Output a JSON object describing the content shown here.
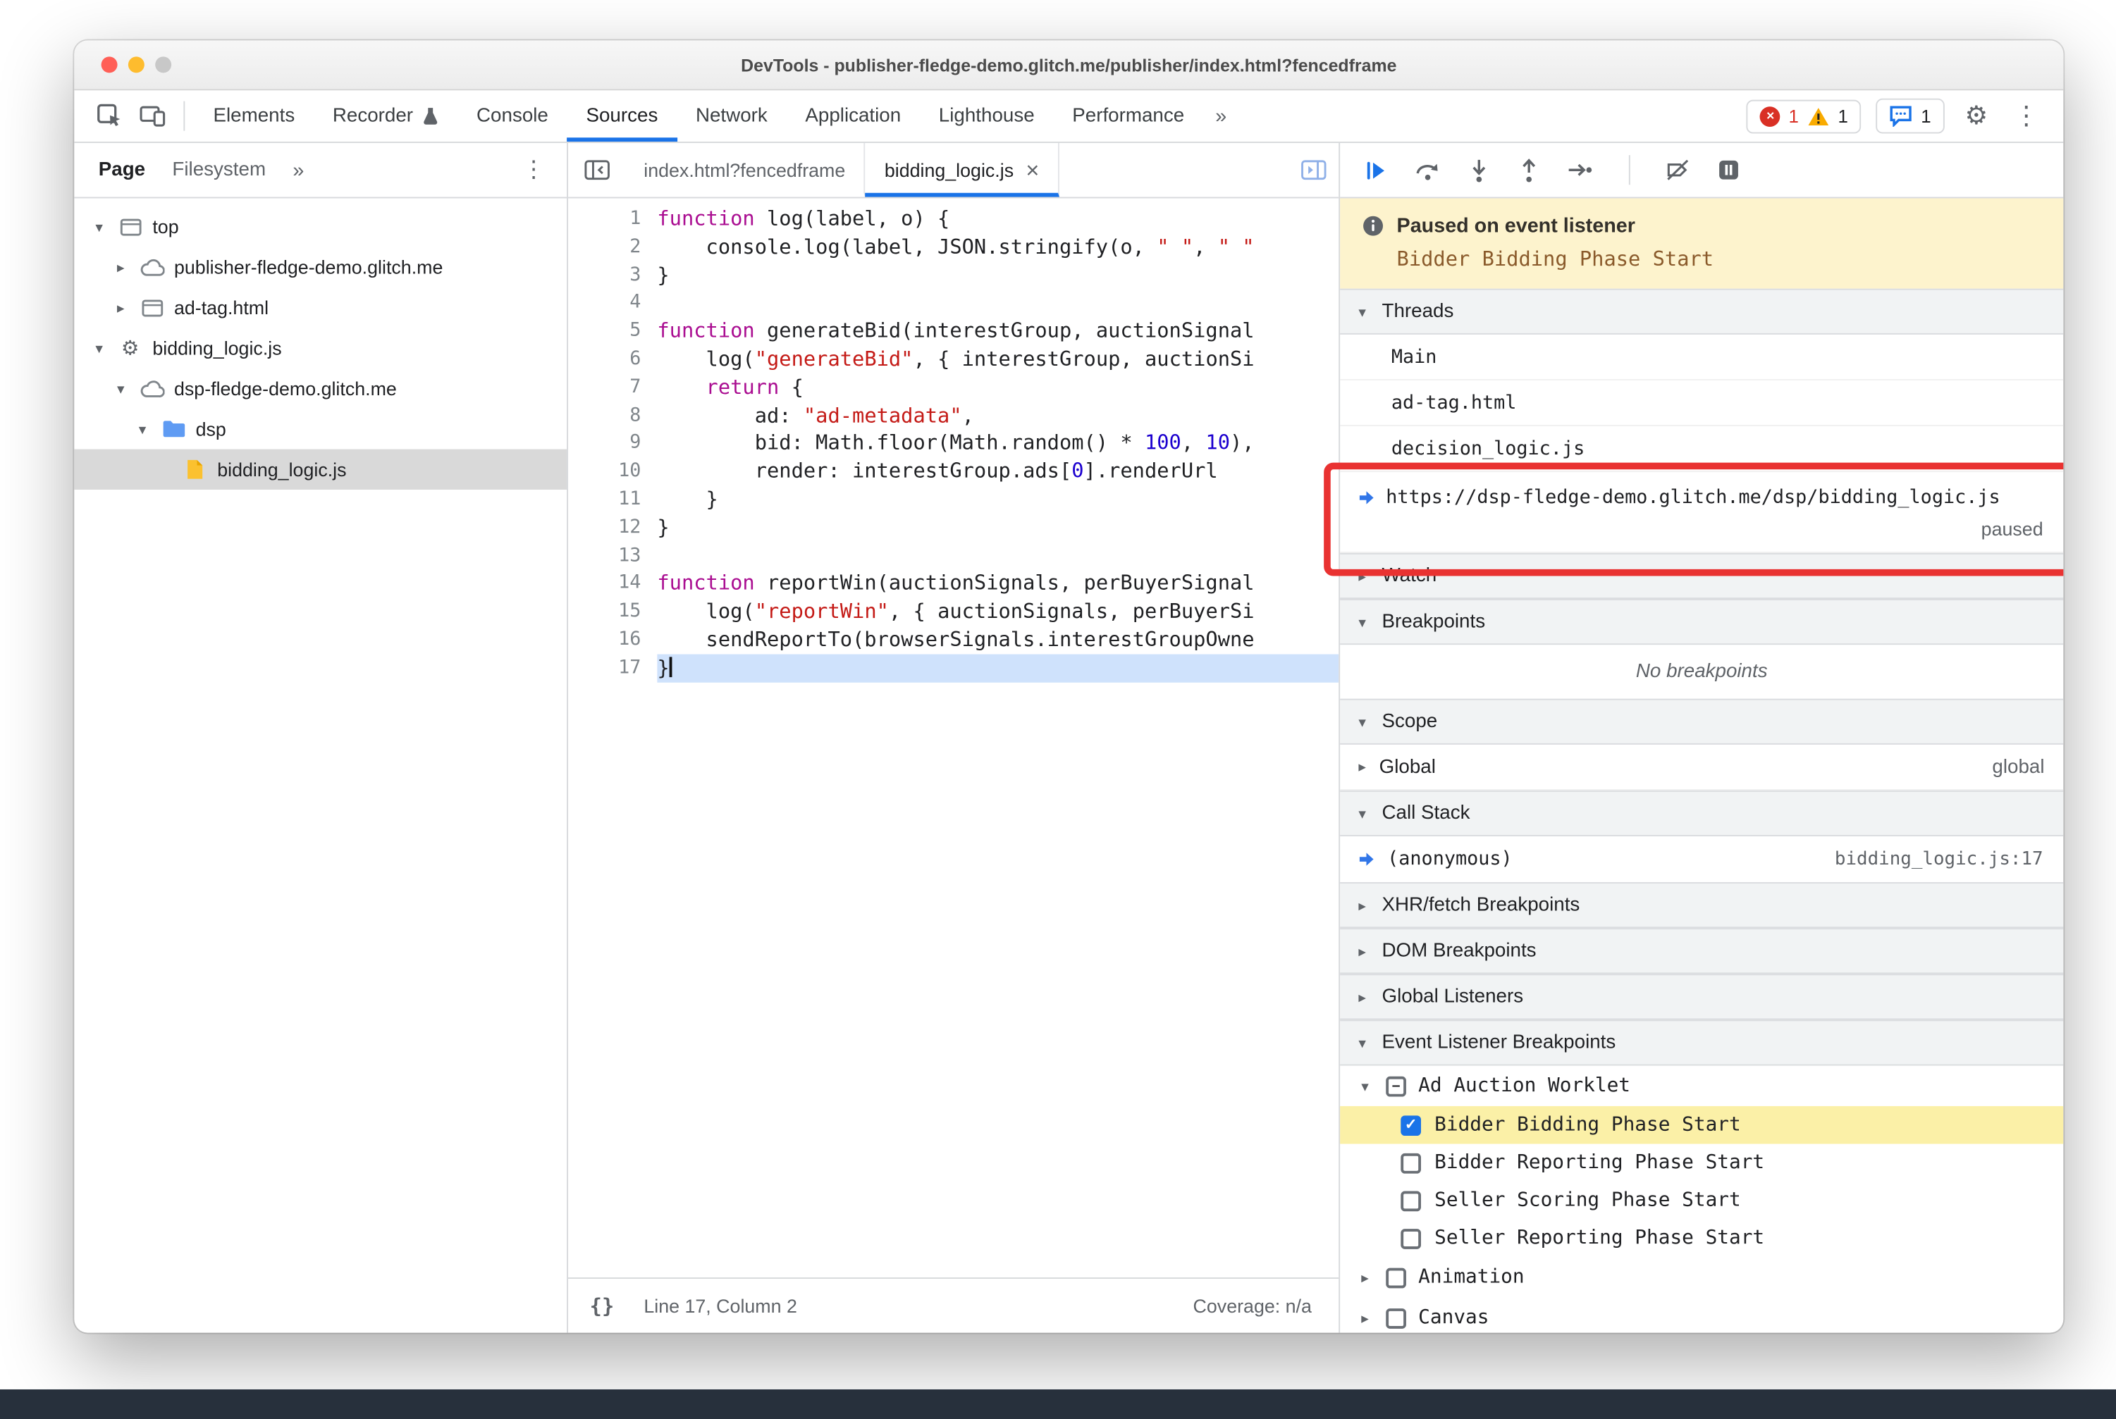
{
  "window": {
    "title": "DevTools - publisher-fledge-demo.glitch.me/publisher/index.html?fencedframe"
  },
  "icons": {
    "kebab": "⋮",
    "gear": "⚙",
    "chevrons": "»",
    "close": "×",
    "check": "✓",
    "minus": "–",
    "tri_down": "▾",
    "tri_right": "▸",
    "braces": "{}"
  },
  "colors": {
    "accent": "#1a73e8",
    "error": "#d93025",
    "warning": "#f9ab00",
    "annotation_red": "#e93231",
    "paused_banner_bg": "#fdf3cd",
    "elb_highlight": "#fbf0a7",
    "selected_row": "#d9d9d9",
    "paused_line": "#cfe2fc"
  },
  "chrome_toolbar": {
    "tabs": [
      {
        "label": "Elements"
      },
      {
        "label": "Recorder",
        "icon": "flask-icon"
      },
      {
        "label": "Console"
      },
      {
        "label": "Sources",
        "selected": true
      },
      {
        "label": "Network"
      },
      {
        "label": "Application"
      },
      {
        "label": "Lighthouse"
      },
      {
        "label": "Performance"
      }
    ],
    "overflow": "»",
    "errors": "1",
    "warnings": "1",
    "issues": "1"
  },
  "navigator": {
    "tabs": [
      {
        "label": "Page",
        "selected": true
      },
      {
        "label": "Filesystem"
      }
    ],
    "overflow": "»",
    "tree": [
      {
        "label": "top",
        "icon": "frame",
        "depth": 0,
        "exp": "open"
      },
      {
        "label": "publisher-fledge-demo.glitch.me",
        "icon": "cloud",
        "depth": 1,
        "exp": "closed"
      },
      {
        "label": "ad-tag.html",
        "icon": "frame",
        "depth": 1,
        "exp": "closed"
      },
      {
        "label": "bidding_logic.js",
        "icon": "gear",
        "depth": 0,
        "exp": "open"
      },
      {
        "label": "dsp-fledge-demo.glitch.me",
        "icon": "cloud",
        "depth": 1,
        "exp": "open"
      },
      {
        "label": "dsp",
        "icon": "folder",
        "depth": 2,
        "exp": "open"
      },
      {
        "label": "bidding_logic.js",
        "icon": "file",
        "depth": 3,
        "exp": "none",
        "selected": true
      }
    ]
  },
  "editor": {
    "tabs": [
      {
        "label": "index.html?fencedframe"
      },
      {
        "label": "bidding_logic.js",
        "active": true,
        "closable": true
      }
    ],
    "lines": [
      {
        "seg": [
          [
            "k",
            "function"
          ],
          [
            "p",
            " log(label, o) {"
          ]
        ]
      },
      {
        "seg": [
          [
            "p",
            "    console.log(label, JSON.stringify(o, "
          ],
          [
            "s",
            "\" \""
          ],
          [
            "p",
            ", "
          ],
          [
            "s",
            "\" \""
          ]
        ]
      },
      {
        "seg": [
          [
            "p",
            "}"
          ]
        ]
      },
      {
        "seg": []
      },
      {
        "seg": [
          [
            "k",
            "function"
          ],
          [
            "p",
            " generateBid(interestGroup, auctionSignal"
          ]
        ]
      },
      {
        "seg": [
          [
            "p",
            "    log("
          ],
          [
            "s",
            "\"generateBid\""
          ],
          [
            "p",
            ", { interestGroup, auctionSi"
          ]
        ]
      },
      {
        "seg": [
          [
            "p",
            "    "
          ],
          [
            "k",
            "return"
          ],
          [
            "p",
            " {"
          ]
        ]
      },
      {
        "seg": [
          [
            "p",
            "        ad: "
          ],
          [
            "s",
            "\"ad-metadata\""
          ],
          [
            "p",
            ","
          ]
        ]
      },
      {
        "seg": [
          [
            "p",
            "        bid: Math.floor(Math.random() * "
          ],
          [
            "n",
            "100"
          ],
          [
            "p",
            ", "
          ],
          [
            "n",
            "10"
          ],
          [
            "p",
            "),"
          ]
        ]
      },
      {
        "seg": [
          [
            "p",
            "        render: interestGroup.ads["
          ],
          [
            "n",
            "0"
          ],
          [
            "p",
            "].renderUrl"
          ]
        ]
      },
      {
        "seg": [
          [
            "p",
            "    }"
          ]
        ]
      },
      {
        "seg": [
          [
            "p",
            "}"
          ]
        ]
      },
      {
        "seg": []
      },
      {
        "seg": [
          [
            "k",
            "function"
          ],
          [
            "p",
            " reportWin(auctionSignals, perBuyerSignal"
          ]
        ]
      },
      {
        "seg": [
          [
            "p",
            "    log("
          ],
          [
            "s",
            "\"reportWin\""
          ],
          [
            "p",
            ", { auctionSignals, perBuyerSi"
          ]
        ]
      },
      {
        "seg": [
          [
            "p",
            "    sendReportTo(browserSignals.interestGroupOwne"
          ]
        ]
      },
      {
        "seg": [
          [
            "p",
            "}"
          ]
        ],
        "paused": true
      }
    ],
    "status": {
      "braces": "{}",
      "position": "Line 17, Column 2",
      "coverage": "Coverage: n/a"
    }
  },
  "debugger": {
    "banner": {
      "title": "Paused on event listener",
      "detail": "Bidder Bidding Phase Start"
    },
    "sections": [
      {
        "id": "threads",
        "title": "Threads",
        "expanded": true,
        "type": "threads",
        "items": [
          {
            "label": "Main"
          },
          {
            "label": "ad-tag.html"
          },
          {
            "label": "decision_logic.js"
          },
          {
            "label": "https://dsp-fledge-demo.glitch.me/dsp/bidding_logic.js",
            "status": "paused",
            "current": true
          }
        ]
      },
      {
        "id": "watch",
        "title": "Watch",
        "expanded": false,
        "type": "plain"
      },
      {
        "id": "breakpoints",
        "title": "Breakpoints",
        "expanded": true,
        "type": "note",
        "note": "No breakpoints"
      },
      {
        "id": "scope",
        "title": "Scope",
        "expanded": true,
        "type": "kv",
        "rows": [
          {
            "label": "Global",
            "value": "global"
          }
        ]
      },
      {
        "id": "call-stack",
        "title": "Call Stack",
        "expanded": true,
        "type": "stack",
        "rows": [
          {
            "label": "(anonymous)",
            "loc": "bidding_logic.js:17",
            "current": true
          }
        ]
      },
      {
        "id": "xhr-fetch-breakpoints",
        "title": "XHR/fetch Breakpoints",
        "expanded": false,
        "type": "plain"
      },
      {
        "id": "dom-breakpoints",
        "title": "DOM Breakpoints",
        "expanded": false,
        "type": "plain"
      },
      {
        "id": "global-listeners",
        "title": "Global Listeners",
        "expanded": false,
        "type": "plain"
      },
      {
        "id": "event-listener-breakpoints",
        "title": "Event Listener Breakpoints",
        "expanded": true,
        "type": "elb",
        "groups": [
          {
            "label": "Ad Auction Worklet",
            "state": "indeterminate",
            "expanded": true,
            "children": [
              {
                "label": "Bidder Bidding Phase Start",
                "checked": true,
                "highlight": true
              },
              {
                "label": "Bidder Reporting Phase Start",
                "checked": false
              },
              {
                "label": "Seller Scoring Phase Start",
                "checked": false
              },
              {
                "label": "Seller Reporting Phase Start",
                "checked": false
              }
            ]
          },
          {
            "label": "Animation",
            "state": "unchecked",
            "expanded": false
          },
          {
            "label": "Canvas",
            "state": "unchecked",
            "expanded": false
          }
        ]
      }
    ]
  }
}
